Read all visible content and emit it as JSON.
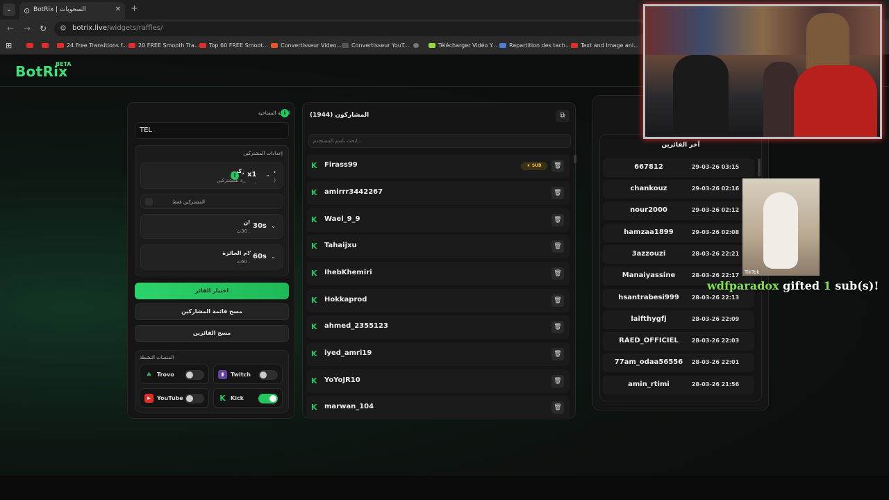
{
  "browser": {
    "tab_title": "BotRix | السحوبات",
    "url_host": "botrix.live",
    "url_path": "/widgets/raffles/",
    "bookmarks": [
      "24 Free Transitions f...",
      "20 FREE Smooth Tra...",
      "Top 60 FREE Smoot...",
      "Convertisseur Video...",
      "Convertisseur YouT...",
      "Télécharger Vidéo Y...",
      "Repartition des tach...",
      "Text and Image ani..."
    ]
  },
  "brand": {
    "logo": "BotRix",
    "beta": "BETA",
    "accent": "#3fe07a"
  },
  "settings": {
    "keyword_label": "الكلمة المفتاحية",
    "keyword_value": "TEL",
    "participants_settings": "إعدادات المشتركين",
    "sub_bonus_title": "ميزة للمشتركين",
    "sub_bonus_desc": "بدون ميزة للمشتركين (OFF)",
    "sub_bonus_value": "x1",
    "subs_only": "المشتركين فقط",
    "spin_title": "مدة الدوران",
    "spin_desc": "المدة الحالية: 30ث",
    "spin_value": "30s",
    "claim_title": "فترة استلام الجائزة",
    "claim_desc": "المدة الحالية: 60ث",
    "claim_value": "60s",
    "pick_winner": "اختيار الفائز",
    "clear_participants": "مسح قائمة المشاركين",
    "clear_winners": "مسح الفائزين",
    "platforms_label": "المنصات النشطة",
    "platforms": [
      {
        "name": "Trovo",
        "on": false
      },
      {
        "name": "Twitch",
        "on": false
      },
      {
        "name": "YouTube",
        "on": false
      },
      {
        "name": "Kick",
        "on": true
      }
    ]
  },
  "participants": {
    "title": "المشاركون (1944)",
    "search_placeholder": "ابحث باسم المستخدم...",
    "sub_badge": "SUB",
    "items": [
      "Firass99",
      "amirrr3442267",
      "Wael_9_9",
      "Tahaijxu",
      "IhebKhemiri",
      "Hokkaprod",
      "ahmed_2355123",
      "iyed_amri19",
      "YoYoJR10",
      "marwan_104"
    ]
  },
  "winners": {
    "title": "آخر الفائزين",
    "items": [
      {
        "name": "667812",
        "date": "29-03-26 03:15"
      },
      {
        "name": "chankouz",
        "date": "29-03-26 02:16"
      },
      {
        "name": "nour2000",
        "date": "29-03-26 02:12"
      },
      {
        "name": "hamzaa1899",
        "date": "29-03-26 02:08"
      },
      {
        "name": "3azzouzi",
        "date": "28-03-26 22:21"
      },
      {
        "name": "Manaiyassine",
        "date": "28-03-26 22:17"
      },
      {
        "name": "hsantrabesi999",
        "date": "28-03-26 22:13"
      },
      {
        "name": "laifthygfj",
        "date": "28-03-26 22:09"
      },
      {
        "name": "RAED_OFFICIEL",
        "date": "28-03-26 22:03"
      },
      {
        "name": "77am_odaa56556",
        "date": "28-03-26 22:01"
      },
      {
        "name": "amin_rtimi",
        "date": "28-03-26 21:56"
      }
    ]
  },
  "overlay": {
    "gift_user": "wdfparadox",
    "gift_mid": "gifted",
    "gift_count": "1",
    "gift_end": "sub(s)!",
    "tiktok": "TikTok"
  }
}
